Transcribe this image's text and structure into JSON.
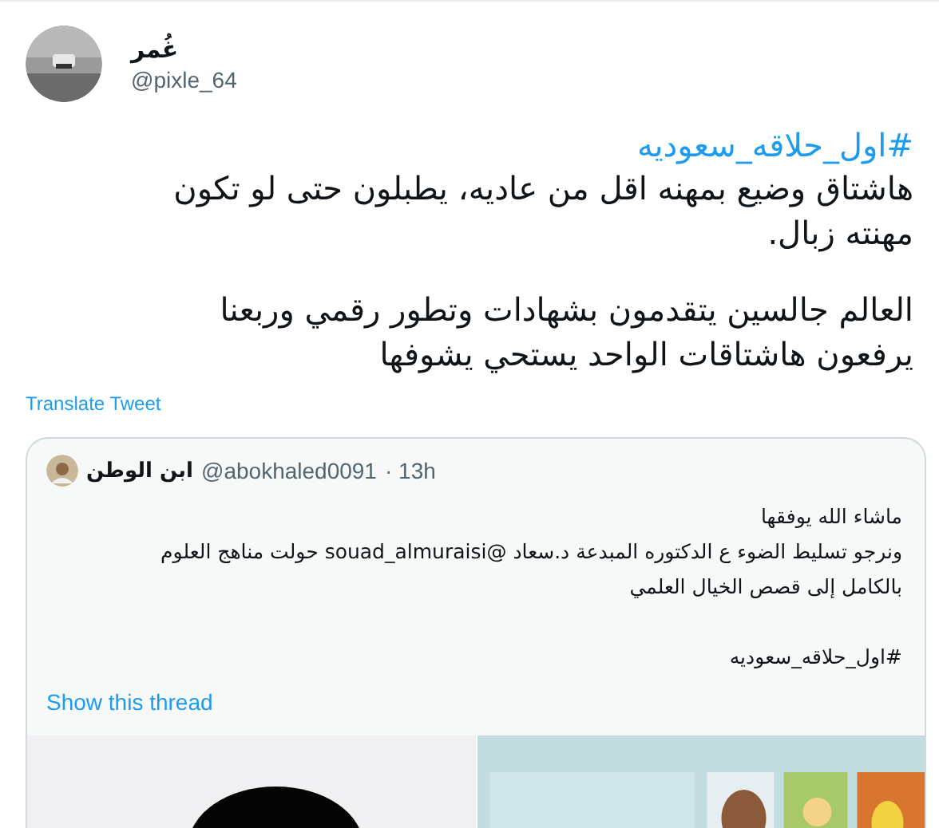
{
  "author": {
    "name": "غُمر",
    "handle": "@pixle_64"
  },
  "hashtag": "#اول_حلاقه_سعوديه",
  "paragraphs": [
    [
      "هاشتاق وضيع بمهنه اقل من عاديه، يطبلون حتى لو تكون",
      "مهنته زبال."
    ],
    [
      "العالم جالسين يتقدمون بشهادات وتطور رقمي  وربعنا",
      "يرفعون هاشتاقات الواحد يستحي يشوفها"
    ]
  ],
  "translate": "Translate Tweet",
  "quote": {
    "name": "ابن الوطن",
    "handle": "@abokhaled0091",
    "time": "· 13h",
    "paragraphs": [
      [
        "ماشاء الله يوفقها",
        "ونرجو تسليط الضوء ع الدكتوره المبدعة د.سعاد @souad_almuraisi حولت مناهج العلوم",
        "بالكامل إلى قصص الخيال العلمي"
      ],
      [
        "#اول_حلاقه_سعوديه"
      ]
    ],
    "thread_link": "Show this thread",
    "media": [
      {
        "kind": "picture"
      },
      {
        "kind": "picture"
      }
    ]
  }
}
